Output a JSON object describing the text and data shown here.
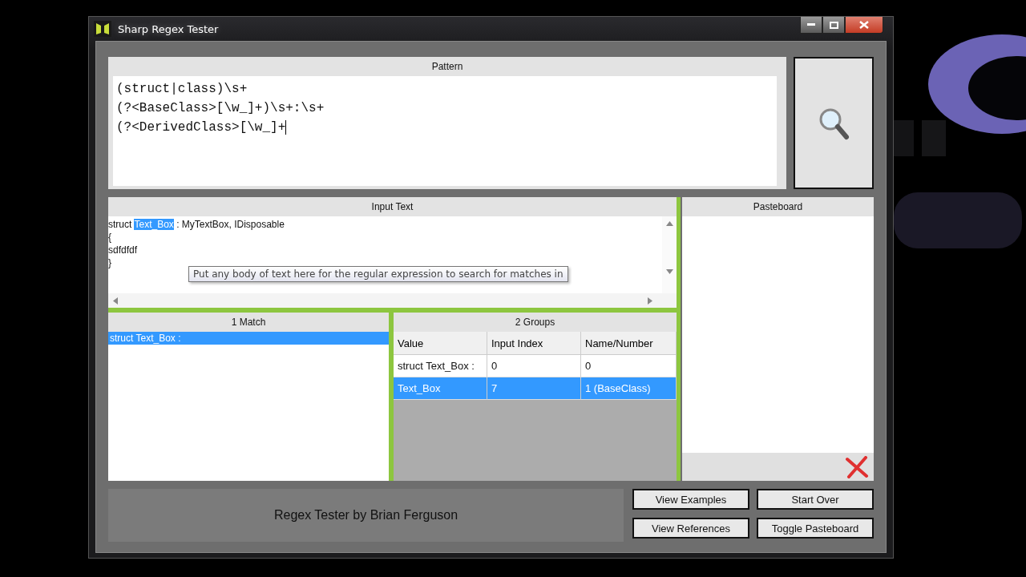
{
  "window": {
    "title": "Sharp Regex Tester"
  },
  "pattern": {
    "title": "Pattern",
    "lines": [
      "(struct|class)\\s+",
      "(?<BaseClass>[\\w_]+)\\s+:\\s+",
      "(?<DerivedClass>[\\w_]+"
    ]
  },
  "input_text": {
    "title": "Input Text",
    "lines": [
      {
        "segments": [
          {
            "text": "struct ",
            "selected": false
          },
          {
            "text": "Text_Box",
            "selected": true
          },
          {
            "text": " : MyTextBox, IDisposable",
            "selected": false
          }
        ]
      },
      {
        "segments": [
          {
            "text": "{",
            "selected": false
          }
        ]
      },
      {
        "segments": [
          {
            "text": "sdfdfdf",
            "selected": false
          }
        ]
      },
      {
        "segments": [
          {
            "text": "}",
            "selected": false
          }
        ]
      }
    ],
    "tooltip": "Put any body of text here for the regular expression to search for matches in"
  },
  "pasteboard": {
    "title": "Pasteboard"
  },
  "matches": {
    "title": "1 Match",
    "items": [
      {
        "text": "struct Text_Box :",
        "selected": true
      }
    ]
  },
  "groups": {
    "title": "2 Groups",
    "columns": [
      "Value",
      "Input Index",
      "Name/Number"
    ],
    "rows": [
      {
        "cells": [
          "struct Text_Box :",
          "0",
          "0"
        ],
        "selected": false
      },
      {
        "cells": [
          "Text_Box",
          "7",
          "1 (BaseClass)"
        ],
        "selected": true
      }
    ]
  },
  "credit": "Regex Tester by Brian Ferguson",
  "buttons": [
    "View Examples",
    "Start Over",
    "View References",
    "Toggle Pasteboard"
  ]
}
